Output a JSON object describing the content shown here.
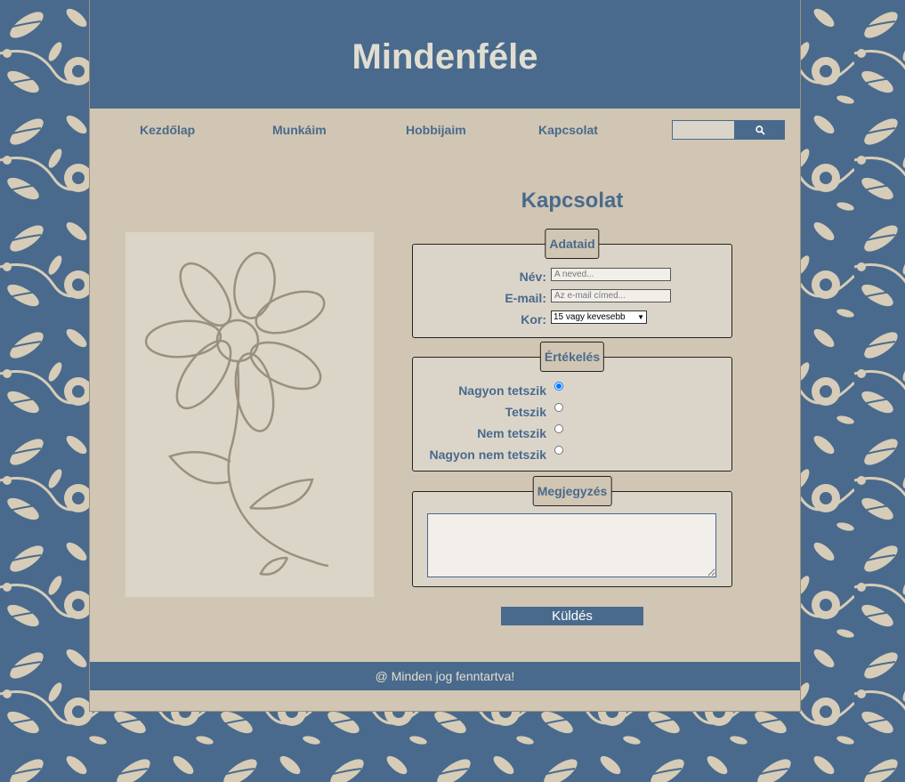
{
  "site_title": "Mindenféle",
  "nav": {
    "items": [
      {
        "label": "Kezdőlap"
      },
      {
        "label": "Munkáim"
      },
      {
        "label": "Hobbijaim"
      },
      {
        "label": "Kapcsolat"
      }
    ],
    "search": {
      "value": "",
      "placeholder": "",
      "icon": "search-icon"
    }
  },
  "contact": {
    "title": "Kapcsolat",
    "details": {
      "legend": "Adataid",
      "name_label": "Név:",
      "name_placeholder": "A neved...",
      "email_label": "E-mail:",
      "email_placeholder": "Az e-mail címed...",
      "age_label": "Kor:",
      "age_selected": "15 vagy kevesebb"
    },
    "rating": {
      "legend": "Értékelés",
      "options": [
        {
          "label": "Nagyon tetszik",
          "checked": true
        },
        {
          "label": "Tetszik",
          "checked": false
        },
        {
          "label": "Nem tetszik",
          "checked": false
        },
        {
          "label": "Nagyon nem tetszik",
          "checked": false
        }
      ]
    },
    "note": {
      "legend": "Megjegyzés",
      "value": ""
    },
    "submit_label": "Küldés"
  },
  "footer": {
    "text": "@ Minden jog fenntartva!"
  },
  "colors": {
    "primary": "#496a8c",
    "page_bg": "#d1c6b3",
    "panel_bg": "#dbd5c9",
    "flower_line": "#9a907e"
  }
}
